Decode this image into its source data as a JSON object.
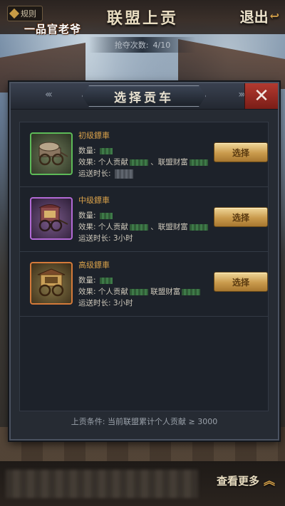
{
  "header": {
    "rules_label": "规则",
    "logo_text": "一品官老爷",
    "title": "联盟上贡",
    "exit_label": "退出"
  },
  "plunder": {
    "label": "抢夺次数:",
    "value": "4/10"
  },
  "dialog": {
    "title": "选择贡车",
    "close_icon": "close-icon",
    "carts": [
      {
        "name": "初级鏢車",
        "quantity_label": "数量:",
        "effect_label": "效果:",
        "effect_personal": "个人贡献",
        "effect_wealth": "、联盟财富",
        "duration_label": "运送时长:",
        "duration_value": "",
        "select_label": "选择",
        "rarity_color": "#5dbb58"
      },
      {
        "name": "中级鏢車",
        "quantity_label": "数量:",
        "effect_label": "效果:",
        "effect_personal": "个人贡献",
        "effect_wealth": "、联盟财富",
        "duration_label": "运送时长:",
        "duration_value": "3小时",
        "select_label": "选择",
        "rarity_color": "#b36ad6"
      },
      {
        "name": "高级鏢車",
        "quantity_label": "数量:",
        "effect_label": "效果:",
        "effect_personal": "个人贡献",
        "effect_wealth": "联盟财富",
        "duration_label": "运送时长:",
        "duration_value": "3小时",
        "select_label": "选择",
        "rarity_color": "#d47a3a"
      }
    ],
    "condition": "上贡条件: 当前联盟累计个人贡献 ≥ 3000"
  },
  "footer": {
    "more_label": "查看更多"
  }
}
